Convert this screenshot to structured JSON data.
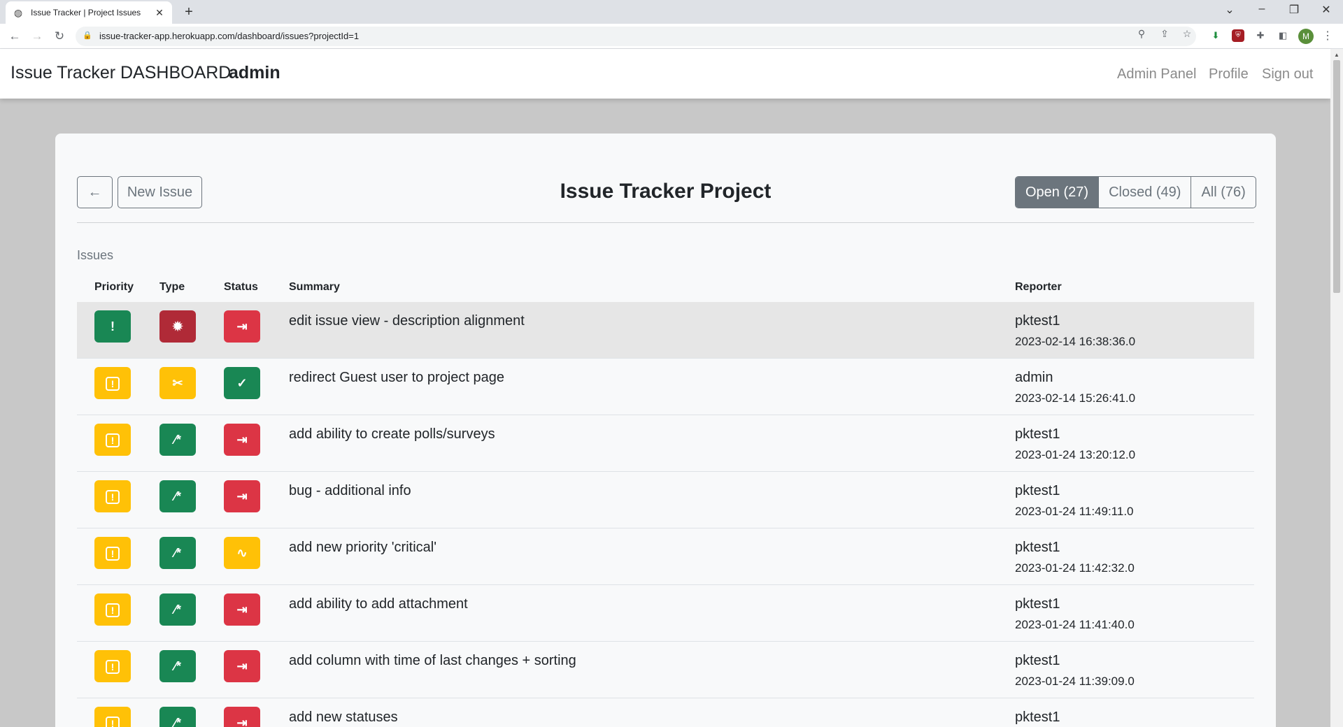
{
  "browser": {
    "tab_title": "Issue Tracker | Project Issues",
    "url": "issue-tracker-app.herokuapp.com/dashboard/issues?projectId=1",
    "avatar_letter": "M"
  },
  "header": {
    "brand": "Issue Tracker DASHBOARD",
    "username": "admin",
    "nav": [
      "Admin Panel",
      "Profile",
      "Sign out"
    ]
  },
  "card": {
    "back_label": "←",
    "new_issue_label": "New Issue",
    "title": "Issue Tracker Project",
    "filters": [
      "Open (27)",
      "Closed (49)",
      "All (76)"
    ],
    "active_filter": "Open (27)",
    "section_label": "Issues"
  },
  "table": {
    "headers": [
      "Priority",
      "Type",
      "Status",
      "Summary",
      "Reporter"
    ],
    "rows": [
      {
        "priority": "high",
        "type": "bug",
        "status": "new",
        "summary": "edit issue view - description alignment",
        "reporter": "pktest1",
        "date": "2023-02-14 16:38:36.0"
      },
      {
        "priority": "medium",
        "type": "fix",
        "status": "done",
        "summary": "redirect Guest user to project page",
        "reporter": "admin",
        "date": "2023-02-14 15:26:41.0"
      },
      {
        "priority": "medium",
        "type": "feature",
        "status": "new",
        "summary": "add ability to create polls/surveys",
        "reporter": "pktest1",
        "date": "2023-01-24 13:20:12.0"
      },
      {
        "priority": "medium",
        "type": "feature",
        "status": "new",
        "summary": "bug - additional info",
        "reporter": "pktest1",
        "date": "2023-01-24 11:49:11.0"
      },
      {
        "priority": "medium",
        "type": "feature",
        "status": "in-progress",
        "summary": "add new priority 'critical'",
        "reporter": "pktest1",
        "date": "2023-01-24 11:42:32.0"
      },
      {
        "priority": "medium",
        "type": "feature",
        "status": "new",
        "summary": "add ability to add attachment",
        "reporter": "pktest1",
        "date": "2023-01-24 11:41:40.0"
      },
      {
        "priority": "medium",
        "type": "feature",
        "status": "new",
        "summary": "add column with time of last changes + sorting",
        "reporter": "pktest1",
        "date": "2023-01-24 11:39:09.0"
      },
      {
        "priority": "medium",
        "type": "feature",
        "status": "new",
        "summary": "add new statuses",
        "reporter": "pktest1",
        "date": ""
      }
    ]
  },
  "colors": {
    "green": "#198754",
    "yellow": "#ffc107",
    "red": "#dc3545",
    "bug_red": "#b02a37",
    "secondary": "#6c757d"
  },
  "icons": {
    "high": "exclamation-icon",
    "medium": "exclamation-square-icon",
    "bug": "bug-icon",
    "fix": "tools-icon",
    "feature": "magic-wand-icon",
    "new": "box-arrow-in-icon",
    "done": "check-icon",
    "in-progress": "activity-icon"
  }
}
